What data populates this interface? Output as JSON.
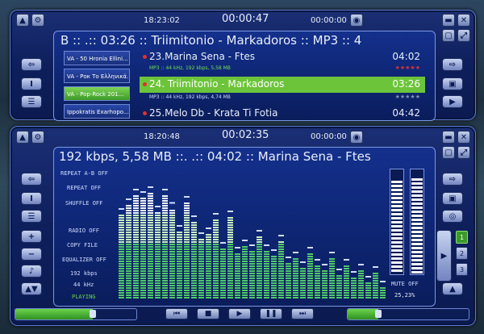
{
  "top": {
    "clock": "18:23:02",
    "elapsed": "00:00:47",
    "remaining": "00:00:00",
    "marquee": "B :: .:: 03:26 :: Triimitonio - Markadoros :: MP3 :: 4",
    "playlists": [
      "VA - 50 Hronia Ellini...",
      "VA - Рок То Ελληνικά...",
      "VA - Pop-Rock 201...",
      "Ippokratis Exarhopo..."
    ],
    "tracks": [
      {
        "title": "23.Marina Sena - Ftes",
        "duration": "04:02",
        "info": "MP3 :: 44 kHz, 192 kbps, 5,58 MB",
        "stars": "★★★★★"
      },
      {
        "title": "24. Triimitonio - Markadoros",
        "duration": "03:26",
        "info": "MP3 :: 44 kHz, 192 kbps, 4,74 MB",
        "stars": "★★★★★"
      },
      {
        "title": "25.Melo Db - Krata Ti Fotia",
        "duration": "04:42"
      }
    ]
  },
  "bottom": {
    "clock": "18:20:48",
    "elapsed": "00:02:35",
    "remaining": "00:00:00",
    "marquee": "192 kbps, 5,58 MB ::. .:: 04:02 :: Marina Sena - Ftes",
    "status": [
      "REPEAT A-B OFF",
      "REPEAT OFF",
      "SHUFFLE OFF",
      "RADIO OFF",
      "COPY FILE",
      "EQUALIZER OFF"
    ],
    "bitrate": "192 kbps",
    "samplerate": "44 kHz",
    "state": "PLAYING",
    "mute": "MUTE OFF",
    "volume": "25,23%",
    "channels": [
      "1",
      "2",
      "3"
    ],
    "seek_progress": 0.64,
    "volume_level": 0.25
  },
  "chart_data": {
    "type": "bar",
    "values": [
      70,
      78,
      86,
      84,
      88,
      72,
      86,
      75,
      56,
      80,
      64,
      50,
      54,
      66,
      42,
      68,
      38,
      44,
      40,
      52,
      40,
      36,
      48,
      30,
      34,
      26,
      38,
      28,
      24,
      34,
      20,
      28,
      18,
      24,
      14,
      22,
      10
    ],
    "vu": [
      90,
      92
    ]
  },
  "colors": {
    "accent_green": "#6bd44a",
    "selected_row": "#6cc43a"
  }
}
